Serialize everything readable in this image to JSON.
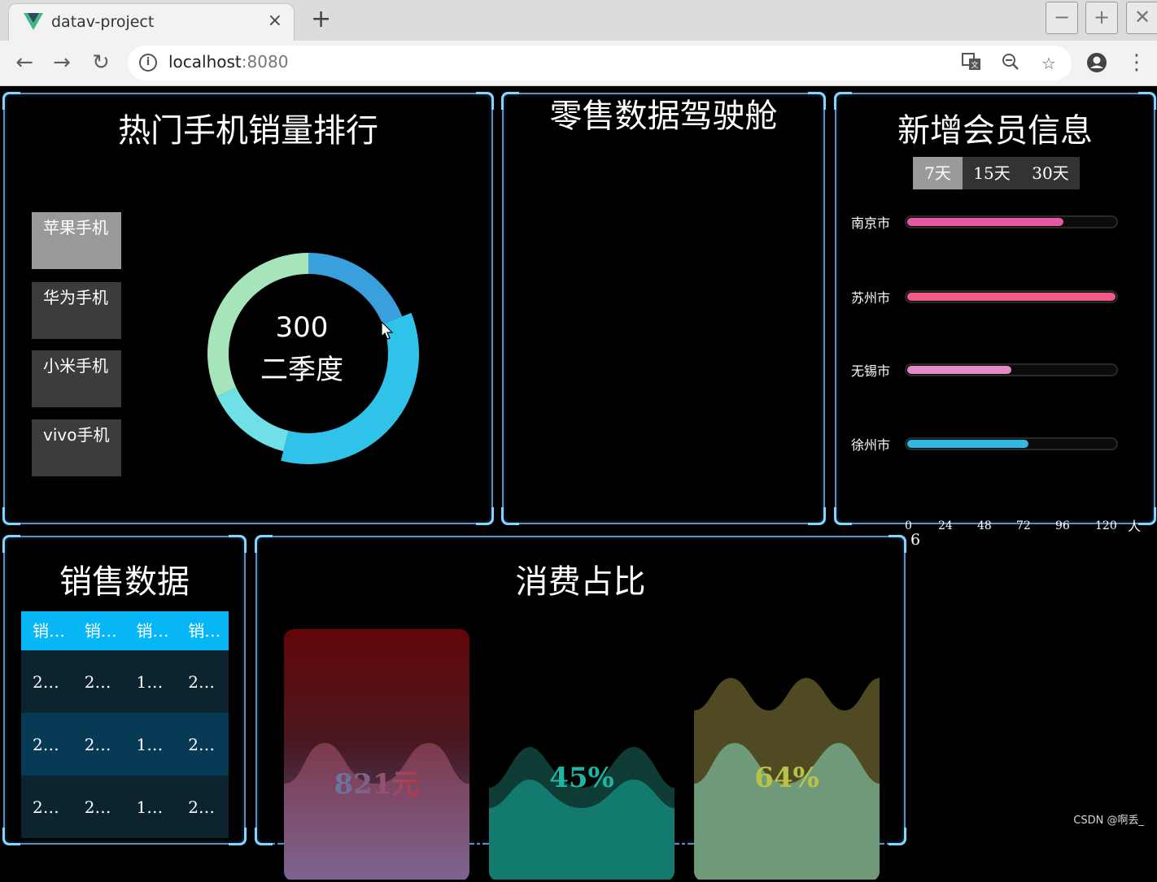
{
  "browser": {
    "tab_title": "datav-project",
    "tab_close": "×",
    "new_tab": "+",
    "window_buttons": [
      "−",
      "+",
      "✕"
    ],
    "url_host": "localhost",
    "url_port": ":8080",
    "icons": [
      "back-arrow-icon",
      "forward-arrow-icon",
      "reload-icon",
      "info-icon",
      "translate-icon",
      "zoom-out-icon",
      "star-icon",
      "account-icon",
      "more-icon"
    ]
  },
  "phones": {
    "title": "热门手机销量排行",
    "brands": [
      "苹果手机",
      "华为手机",
      "小米手机",
      "vivo手机"
    ],
    "active_index": 0,
    "donut": {
      "value": "300",
      "label": "二季度",
      "segments": [
        {
          "color": "#3aa0dd",
          "fraction": 0.19
        },
        {
          "color": "#2fc3ea",
          "fraction": 0.35
        },
        {
          "color": "#6ee0e6",
          "fraction": 0.14
        },
        {
          "color": "#a5e5b9",
          "fraction": 0.32
        }
      ]
    }
  },
  "cockpit": {
    "title": "零售数据驾驶舱"
  },
  "members": {
    "title": "新增会员信息",
    "tabs": [
      "7天",
      "15天",
      "30天"
    ],
    "active_tab": 0,
    "cities": [
      {
        "name": "南京市",
        "value": 90,
        "color": "#e459a3"
      },
      {
        "name": "苏州市",
        "value": 120,
        "color": "#f05a86"
      },
      {
        "name": "无锡市",
        "value": 60,
        "color": "#e48ac5"
      },
      {
        "name": "徐州市",
        "value": 70,
        "color": "#2eb8e6"
      }
    ],
    "axis_ticks": [
      "0",
      "24",
      "48",
      "72",
      "96",
      "120"
    ],
    "axis_unit": "人",
    "axis_max": 120
  },
  "sales": {
    "title": "销售数据",
    "headers": [
      "销…",
      "销…",
      "销…",
      "销…"
    ],
    "rows": [
      [
        "2…",
        "2…",
        "1…",
        "2…"
      ],
      [
        "2…",
        "2…",
        "1…",
        "2…"
      ],
      [
        "2…",
        "2…",
        "1…",
        "2…"
      ]
    ]
  },
  "consumption": {
    "title": "消费占比",
    "cards": [
      {
        "value": "821元",
        "border": "#e01010"
      },
      {
        "value": "45%",
        "border": "#0e8a14"
      },
      {
        "value": "64%",
        "border": "#f0a21c"
      }
    ]
  },
  "stray_text": "6",
  "watermark": "CSDN @啊丢_"
}
